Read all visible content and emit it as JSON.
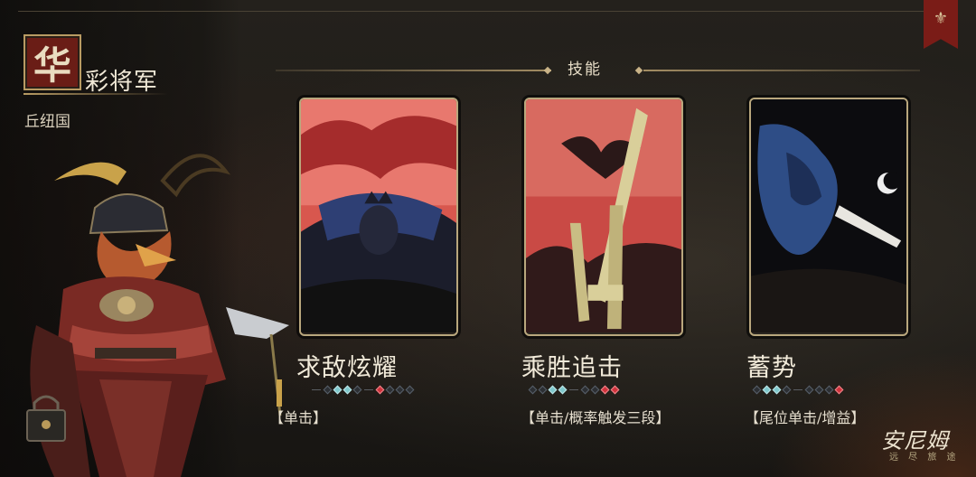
{
  "character": {
    "faction_glyph": "华",
    "name": "彩将军",
    "nation": "丘纽国"
  },
  "header": {
    "section_title": "技能"
  },
  "skills": [
    {
      "name": "求敌炫耀",
      "tag": "【单击】",
      "pips": [
        "empty",
        "cyan",
        "cyan",
        "empty",
        "red",
        "empty",
        "empty",
        "empty"
      ],
      "art_icon": "crowned-knight-wings-art"
    },
    {
      "name": "乘胜追击",
      "tag": "【单击/概率触发三段】",
      "pips": [
        "empty",
        "empty",
        "cyan",
        "cyan",
        "empty",
        "empty",
        "red",
        "red"
      ],
      "art_icon": "bird-and-sword-art"
    },
    {
      "name": "蓄势",
      "tag": "【尾位单击/增益】",
      "pips": [
        "empty",
        "cyan",
        "cyan",
        "empty",
        "empty",
        "empty",
        "empty",
        "red"
      ],
      "art_icon": "warrior-moon-sword-art"
    }
  ],
  "logo": {
    "title": "安尼姆",
    "subtitle": "远 尽 旅 途"
  },
  "colors": {
    "accent_gold": "#b89b63",
    "red": "#d0333d",
    "cyan": "#7fc8cc",
    "ribbon": "#7a1c17"
  },
  "icons": {
    "ribbon": "fleur-de-lis-icon",
    "lock": "lock-icon"
  }
}
